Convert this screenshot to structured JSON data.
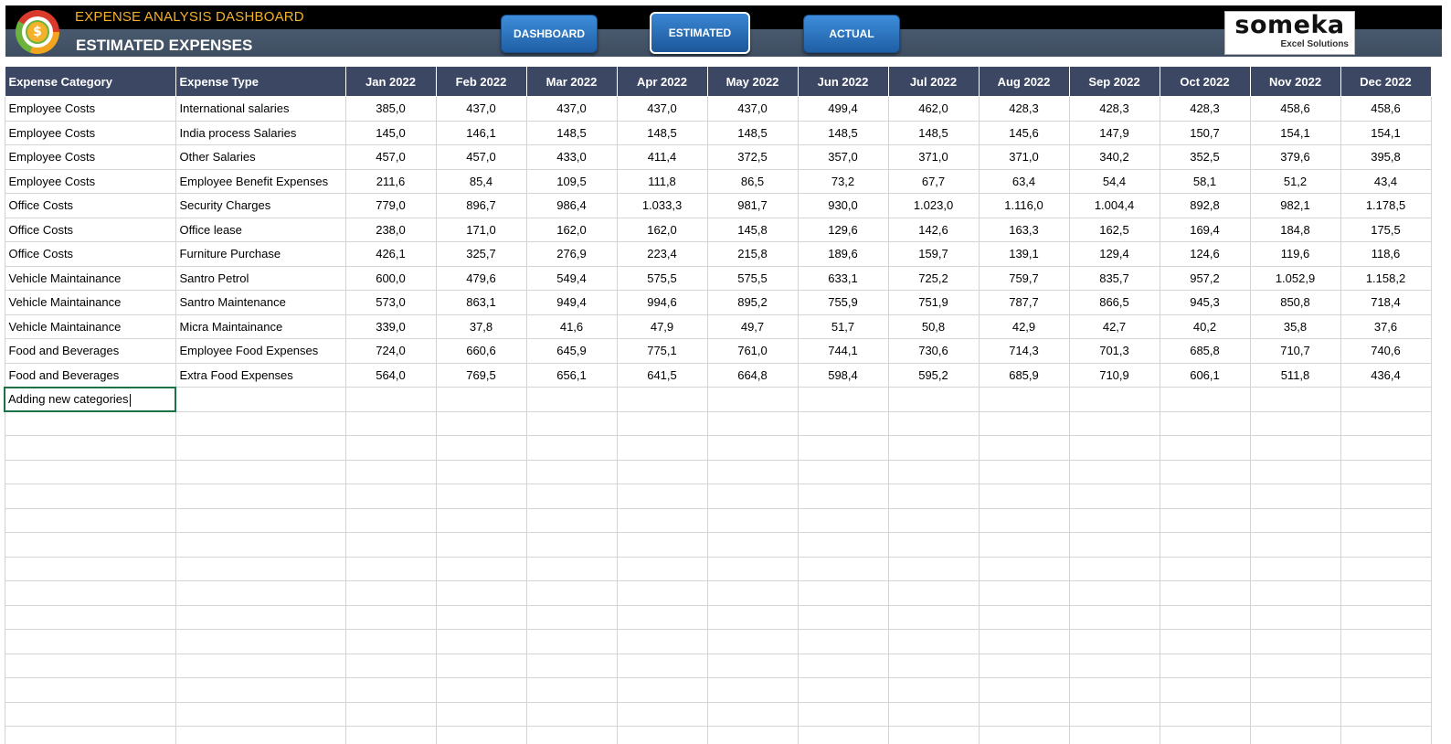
{
  "header": {
    "app_title": "EXPENSE ANALYSIS DASHBOARD",
    "page_title": "ESTIMATED EXPENSES",
    "logo_icon": "dollar-coin-icon",
    "nav": [
      {
        "label": "DASHBOARD",
        "active": false
      },
      {
        "label": "ESTIMATED",
        "active": true
      },
      {
        "label": "ACTUAL",
        "active": false
      }
    ],
    "brand": {
      "name": "someka",
      "sub": "Excel Solutions"
    }
  },
  "table": {
    "columns": [
      "Expense Category",
      "Expense Type",
      "Jan 2022",
      "Feb 2022",
      "Mar 2022",
      "Apr 2022",
      "May 2022",
      "Jun 2022",
      "Jul 2022",
      "Aug 2022",
      "Sep 2022",
      "Oct 2022",
      "Nov 2022",
      "Dec 2022"
    ],
    "rows": [
      [
        "Employee Costs",
        "International salaries",
        "385,0",
        "437,0",
        "437,0",
        "437,0",
        "437,0",
        "499,4",
        "462,0",
        "428,3",
        "428,3",
        "428,3",
        "458,6",
        "458,6"
      ],
      [
        "Employee Costs",
        "India process Salaries",
        "145,0",
        "146,1",
        "148,5",
        "148,5",
        "148,5",
        "148,5",
        "148,5",
        "145,6",
        "147,9",
        "150,7",
        "154,1",
        "154,1"
      ],
      [
        "Employee Costs",
        "Other Salaries",
        "457,0",
        "457,0",
        "433,0",
        "411,4",
        "372,5",
        "357,0",
        "371,0",
        "371,0",
        "340,2",
        "352,5",
        "379,6",
        "395,8"
      ],
      [
        "Employee Costs",
        "Employee Benefit Expenses",
        "211,6",
        "85,4",
        "109,5",
        "111,8",
        "86,5",
        "73,2",
        "67,7",
        "63,4",
        "54,4",
        "58,1",
        "51,2",
        "43,4"
      ],
      [
        "Office Costs",
        "Security Charges",
        "779,0",
        "896,7",
        "986,4",
        "1.033,3",
        "981,7",
        "930,0",
        "1.023,0",
        "1.116,0",
        "1.004,4",
        "892,8",
        "982,1",
        "1.178,5"
      ],
      [
        "Office Costs",
        "Office lease",
        "238,0",
        "171,0",
        "162,0",
        "162,0",
        "145,8",
        "129,6",
        "142,6",
        "163,3",
        "162,5",
        "169,4",
        "184,8",
        "175,5"
      ],
      [
        "Office Costs",
        "Furniture Purchase",
        "426,1",
        "325,7",
        "276,9",
        "223,4",
        "215,8",
        "189,6",
        "159,7",
        "139,1",
        "129,4",
        "124,6",
        "119,6",
        "118,6"
      ],
      [
        "Vehicle Maintainance",
        "Santro Petrol",
        "600,0",
        "479,6",
        "549,4",
        "575,5",
        "575,5",
        "633,1",
        "725,2",
        "759,7",
        "835,7",
        "957,2",
        "1.052,9",
        "1.158,2"
      ],
      [
        "Vehicle Maintainance",
        "Santro Maintenance",
        "573,0",
        "863,1",
        "949,4",
        "994,6",
        "895,2",
        "755,9",
        "751,9",
        "787,7",
        "866,5",
        "945,3",
        "850,8",
        "718,4"
      ],
      [
        "Vehicle Maintainance",
        "Micra Maintainance",
        "339,0",
        "37,8",
        "41,6",
        "47,9",
        "49,7",
        "51,7",
        "50,8",
        "42,9",
        "42,7",
        "40,2",
        "35,8",
        "37,6"
      ],
      [
        "Food and Beverages",
        "Employee Food Expenses",
        "724,0",
        "660,6",
        "645,9",
        "775,1",
        "761,0",
        "744,1",
        "730,6",
        "714,3",
        "701,3",
        "685,8",
        "710,7",
        "740,6"
      ],
      [
        "Food and Beverages",
        "Extra Food Expenses",
        "564,0",
        "769,5",
        "656,1",
        "641,5",
        "664,8",
        "598,4",
        "595,2",
        "685,9",
        "710,9",
        "606,1",
        "511,8",
        "436,4"
      ]
    ],
    "editing_cell_value": "Adding new categories",
    "empty_rows": 15
  },
  "colors": {
    "header_band": "#3c4763",
    "title_accent": "#f4b12c",
    "nav_button": "#2a72c0",
    "selection_border": "#1e7145"
  }
}
